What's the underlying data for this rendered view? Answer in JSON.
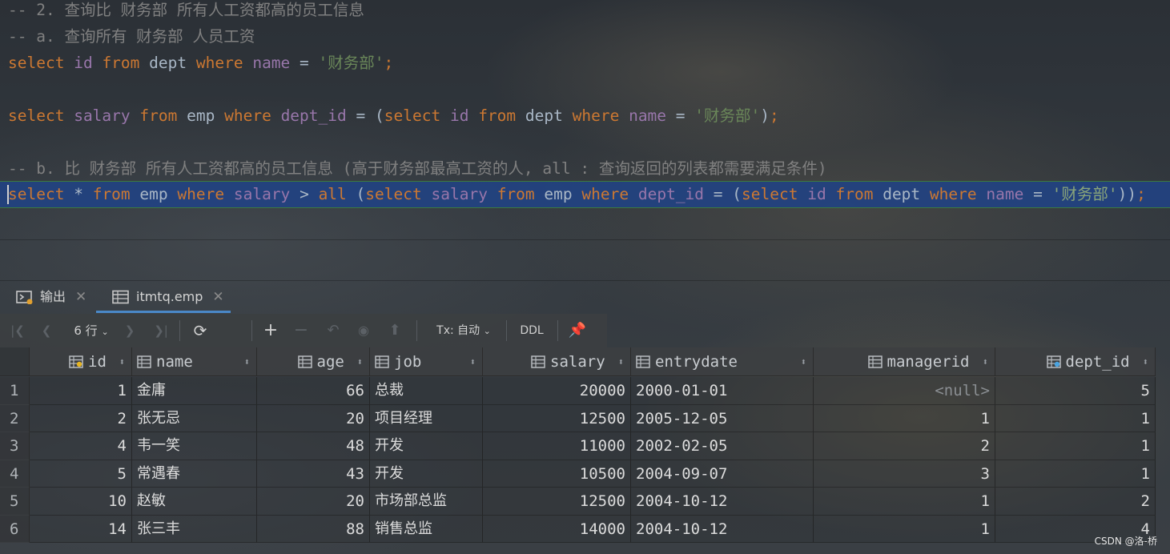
{
  "editor": {
    "line1_comment": "-- 2. 查询比 财务部 所有人工资都高的员工信息",
    "line2_comment": "-- a. 查询所有 财务部 人员工资",
    "line3": {
      "kw_select": "select",
      "col_id": "id",
      "kw_from": "from",
      "tbl": "dept",
      "kw_where": "where",
      "col_name": "name",
      "op": "=",
      "str": "'财务部'",
      "end": ";"
    },
    "line5": {
      "kw_select": "select",
      "col_salary": "salary",
      "kw_from": "from",
      "tbl": "emp",
      "kw_where": "where",
      "col_dept_id": "dept_id",
      "op": "=",
      "paren_open": "(",
      "kw_select2": "select",
      "col_id": "id",
      "kw_from2": "from",
      "tbl2": "dept",
      "kw_where2": "where",
      "col_name": "name",
      "op2": "=",
      "str": "'财务部'",
      "paren_close": ")",
      "end": ";"
    },
    "line7_comment": "-- b. 比 财务部 所有人工资都高的员工信息 (高于财务部最高工资的人, all : 查询返回的列表都需要满足条件)",
    "line8": {
      "kw_select": "select",
      "star": "*",
      "kw_from": "from",
      "tbl": "emp",
      "kw_where": "where",
      "col_salary": "salary",
      "op_gt": ">",
      "kw_all": "all",
      "paren1": "(",
      "kw_select2": "select",
      "col_salary2": "salary",
      "kw_from2": "from",
      "tbl2": "emp",
      "kw_where2": "where",
      "col_dept_id": "dept_id",
      "op": "=",
      "paren2": "(",
      "kw_select3": "select",
      "col_id": "id",
      "kw_from3": "from",
      "tbl3": "dept",
      "kw_where3": "where",
      "col_name": "name",
      "op2": "=",
      "str": "'财务部'",
      "close": "))",
      "end": ";"
    }
  },
  "tabs": [
    {
      "label": "输出",
      "icon": "console-icon"
    },
    {
      "label": "itmtq.emp",
      "icon": "table-icon"
    }
  ],
  "toolbar": {
    "rows_label": "6 行",
    "tx_label": "Tx: 自动",
    "ddl_label": "DDL"
  },
  "grid": {
    "columns": [
      {
        "name": "id",
        "icon": "primary-key-column-icon"
      },
      {
        "name": "name",
        "icon": "column-icon"
      },
      {
        "name": "age",
        "icon": "column-icon"
      },
      {
        "name": "job",
        "icon": "column-icon"
      },
      {
        "name": "salary",
        "icon": "column-icon"
      },
      {
        "name": "entrydate",
        "icon": "column-icon"
      },
      {
        "name": "managerid",
        "icon": "column-icon"
      },
      {
        "name": "dept_id",
        "icon": "foreign-key-column-icon"
      }
    ],
    "rows": [
      {
        "n": "1",
        "id": "1",
        "name": "金庸",
        "age": "66",
        "job": "总裁",
        "salary": "20000",
        "entrydate": "2000-01-01",
        "managerid": "<null>",
        "dept_id": "5"
      },
      {
        "n": "2",
        "id": "2",
        "name": "张无忌",
        "age": "20",
        "job": "项目经理",
        "salary": "12500",
        "entrydate": "2005-12-05",
        "managerid": "1",
        "dept_id": "1"
      },
      {
        "n": "3",
        "id": "4",
        "name": "韦一笑",
        "age": "48",
        "job": "开发",
        "salary": "11000",
        "entrydate": "2002-02-05",
        "managerid": "2",
        "dept_id": "1"
      },
      {
        "n": "4",
        "id": "5",
        "name": "常遇春",
        "age": "43",
        "job": "开发",
        "salary": "10500",
        "entrydate": "2004-09-07",
        "managerid": "3",
        "dept_id": "1"
      },
      {
        "n": "5",
        "id": "10",
        "name": "赵敏",
        "age": "20",
        "job": "市场部总监",
        "salary": "12500",
        "entrydate": "2004-10-12",
        "managerid": "1",
        "dept_id": "2"
      },
      {
        "n": "6",
        "id": "14",
        "name": "张三丰",
        "age": "88",
        "job": "销售总监",
        "salary": "14000",
        "entrydate": "2004-10-12",
        "managerid": "1",
        "dept_id": "4"
      }
    ]
  },
  "watermark": "CSDN @洛-桥",
  "colors": {
    "keyword": "#cc7832",
    "column": "#9876aa",
    "string": "#6a8759",
    "comment": "#808080",
    "selection": "#214283",
    "accent": "#4a88c7"
  }
}
